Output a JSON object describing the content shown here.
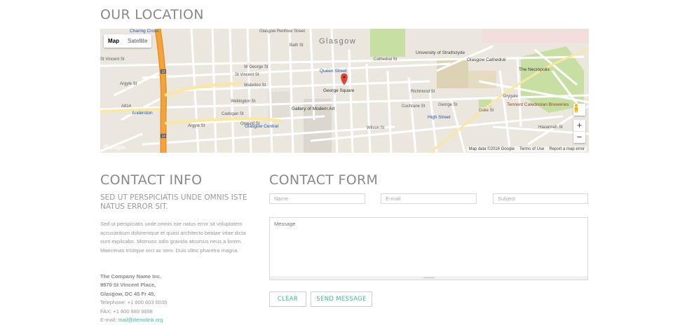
{
  "location": {
    "title": "OUR LOCATION"
  },
  "map": {
    "tabs": [
      "Map",
      "Satellite"
    ],
    "city_label": "Glasgow",
    "street_labels": [
      "Glasgow Renfrew Street",
      "St Vincent St",
      "W George St",
      "Bath St",
      "Argyle St",
      "Waterloo St",
      "Douglas St",
      "Hope St",
      "Renfield St",
      "Wellington St",
      "Cadogan St",
      "Oswald St",
      "W Nile St",
      "N Hanover St",
      "Miller St",
      "Queen St",
      "Virginia St",
      "Wilson St",
      "Ingram St",
      "Albion St",
      "Candleriggs",
      "Cochrane St",
      "Cathedral St",
      "Richmond St",
      "George St",
      "Duke St",
      "Havannah St",
      "Drygate",
      "Collins St",
      "Taylor St",
      "John Knox St",
      "Wishart St",
      "Stirling Rd",
      "Elmbank St",
      "North St",
      "Dunblane St",
      "A814",
      "Bothwell St",
      "Glassford St"
    ],
    "places": [
      "Charing Cross",
      "Queen Street",
      "George Square",
      "Gallery of Modern Art",
      "Glasgow Central",
      "Anderston",
      "University of Strathclyde",
      "Glasgow Cathedral",
      "The Necropolis",
      "Tennent Caledonian Breweries",
      "High Street"
    ],
    "motorway_badges": [
      "18",
      "18"
    ],
    "attribution": [
      "Map data ©2016 Google",
      "Terms of Use",
      "Report a map error"
    ],
    "google_logo": "Google",
    "zoom_in": "+",
    "zoom_out": "−",
    "pegman_icon": "pegman-icon",
    "marker_color": "#e0483d"
  },
  "contact_info": {
    "title": "CONTACT INFO",
    "lead": "SED UT PERSPICIATIS UNDE OMNIS ISTE NATUS ERROR SIT.",
    "paragraph": "Sed ut perspiciatis unde omnis iste natus error sit voluptatem accusantium doloremque et quasi architecto beatae vitae dicta sunt explicabo. Mornunc odio gravida atcursus neus a lorem. Maecenas tristique orci ac sem. Duis ultric pharetra magna.",
    "company": "The Company Name Inc.",
    "street": "9870 St Vincent Place,",
    "city": "Glasgow, DC 45 Fr 45.",
    "telephone": "Telephone: +1 800 603 6035",
    "fax": "FAX: +1 800 889 9898",
    "email_label": "E-mail: ",
    "email": "mail@demolink.org"
  },
  "contact_form": {
    "title": "CONTACT FORM",
    "name_placeholder": "Name",
    "email_placeholder": "E-mail",
    "subject_placeholder": "Subject",
    "message_placeholder": "Message",
    "clear_label": "CLEAR",
    "send_label": "SEND MESSAGE"
  },
  "colors": {
    "accent": "#3cb9a0",
    "heading": "#8a8a8a",
    "map_bg": "#ebe7df",
    "motorway": "#f3a23c",
    "park": "#c8dfa4"
  }
}
